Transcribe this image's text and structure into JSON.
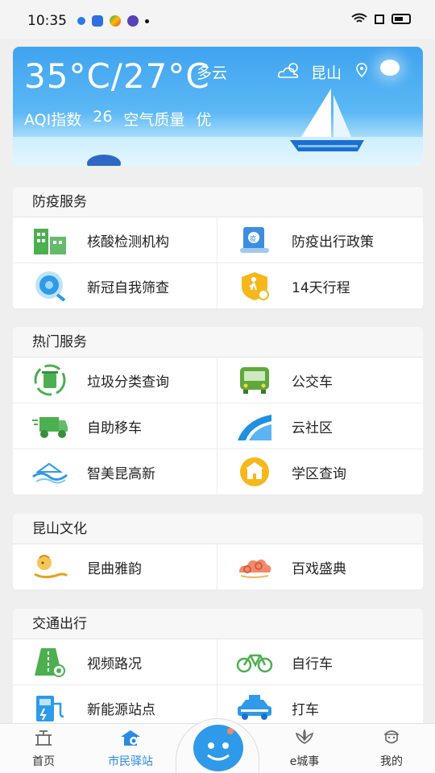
{
  "status_bar": {
    "time": "10:35"
  },
  "weather": {
    "temp": "35°C/27°C",
    "condition": "多云",
    "city": "昆山",
    "aqi_label": "AQI指数",
    "aqi_value": "26",
    "quality_label": "空气质量",
    "quality_value": "优"
  },
  "sections": [
    {
      "title": "防疫服务",
      "items": [
        {
          "label": "核酸检测机构",
          "icon": "building-icon"
        },
        {
          "label": "防疫出行政策",
          "icon": "policy-scroll-icon"
        },
        {
          "label": "新冠自我筛查",
          "icon": "virus-search-icon"
        },
        {
          "label": "14天行程",
          "icon": "walking-shield-icon"
        }
      ]
    },
    {
      "title": "热门服务",
      "items": [
        {
          "label": "垃圾分类查询",
          "icon": "recycle-bin-icon"
        },
        {
          "label": "公交车",
          "icon": "bus-icon"
        },
        {
          "label": "自助移车",
          "icon": "car-move-icon"
        },
        {
          "label": "云社区",
          "icon": "community-icon"
        },
        {
          "label": "智美昆高新",
          "icon": "city-wave-icon"
        },
        {
          "label": "学区查询",
          "icon": "school-icon"
        }
      ]
    },
    {
      "title": "昆山文化",
      "items": [
        {
          "label": "昆曲雅韵",
          "icon": "opera-icon"
        },
        {
          "label": "百戏盛典",
          "icon": "auspicious-cloud-icon"
        }
      ]
    },
    {
      "title": "交通出行",
      "items": [
        {
          "label": "视频路况",
          "icon": "road-camera-icon"
        },
        {
          "label": "自行车",
          "icon": "bicycle-icon"
        },
        {
          "label": "新能源站点",
          "icon": "charging-station-icon"
        },
        {
          "label": "打车",
          "icon": "taxi-icon"
        }
      ]
    }
  ],
  "nav": {
    "home": "首页",
    "station": "市民驿站",
    "ecity": "e城事",
    "mine": "我的"
  },
  "colors": {
    "accent": "#2a8ae6",
    "green": "#4caf50",
    "yellow": "#f5b81c"
  }
}
